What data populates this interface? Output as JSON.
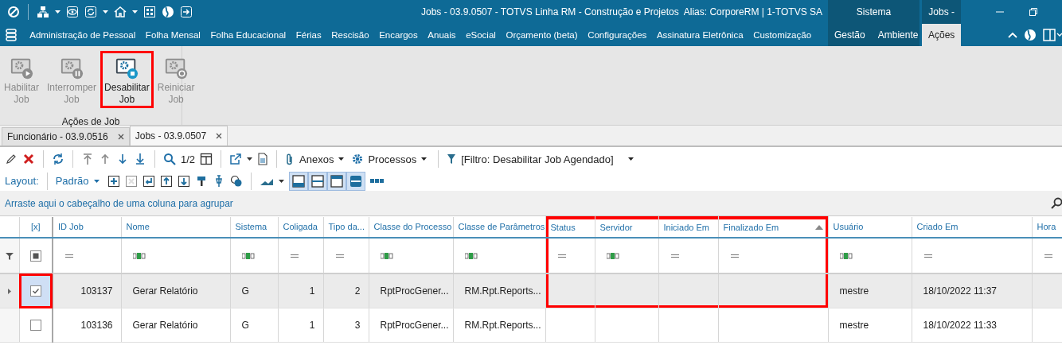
{
  "window": {
    "title": "Jobs - 03.9.0507 - TOTVS Linha RM - Construção e Projetos",
    "alias": "Alias: CorporeRM | 1-TOTVS SA"
  },
  "menu": {
    "items": [
      {
        "label": "Administração de Pessoal",
        "selected": false
      },
      {
        "label": "Folha Mensal",
        "selected": false
      },
      {
        "label": "Folha Educacional",
        "selected": false
      },
      {
        "label": "Férias",
        "selected": false
      },
      {
        "label": "Rescisão",
        "selected": false
      },
      {
        "label": "Encargos",
        "selected": false
      },
      {
        "label": "Anuais",
        "selected": false
      },
      {
        "label": "eSocial",
        "selected": false
      },
      {
        "label": "Orçamento (beta)",
        "selected": false
      },
      {
        "label": "Configurações",
        "selected": false
      },
      {
        "label": "Assinatura Eletrônica",
        "selected": false
      },
      {
        "label": "Customização",
        "selected": false
      }
    ]
  },
  "context_groups": [
    {
      "title": "Sistema",
      "tabs": [
        {
          "label": "Gestão",
          "selected": false
        },
        {
          "label": "Ambiente",
          "selected": false
        }
      ]
    },
    {
      "title": "Jobs -",
      "tabs": [
        {
          "label": "Ações",
          "selected": true
        }
      ]
    }
  ],
  "ribbon": {
    "groups": [
      {
        "label": "Ações de Job",
        "buttons": [
          {
            "label": "Habilitar Job",
            "disabled": true,
            "highlighted": false
          },
          {
            "label": "Interromper Job",
            "disabled": true,
            "highlighted": false
          },
          {
            "label": "Desabilitar Job",
            "disabled": false,
            "highlighted": true
          },
          {
            "label": "Reiniciar Job",
            "disabled": true,
            "highlighted": false
          }
        ]
      }
    ]
  },
  "document_tabs": [
    {
      "label": "Funcionário - 03.9.0516",
      "selected": false
    },
    {
      "label": "Jobs - 03.9.0507",
      "selected": true
    }
  ],
  "toolbar": {
    "page": "1/2",
    "attachments": "Anexos",
    "processes": "Processos",
    "filter": "[Filtro: Desabilitar Job Agendado]"
  },
  "layout_bar": {
    "label": "Layout:",
    "layout": "Padrão",
    "tools": [
      {
        "disabled": false
      },
      {
        "disabled": true
      },
      {
        "disabled": false
      },
      {
        "disabled": false
      },
      {
        "disabled": false
      },
      {
        "disabled": false
      },
      {
        "disabled": false
      },
      {
        "disabled": false
      }
    ],
    "view_toggles": [
      {
        "pressed": true
      },
      {
        "pressed": true
      },
      {
        "pressed": true
      },
      {
        "pressed": true
      }
    ]
  },
  "group_panel": {
    "hint": "Arraste aqui o cabeçalho de uma coluna para agrupar"
  },
  "grid": {
    "select_all_partial": true,
    "columns": [
      {
        "title": "[x]",
        "kind": "check",
        "highlighted": false
      },
      {
        "title": "ID Job",
        "kind": "data",
        "text_filter": false,
        "numeric": true,
        "highlighted": false
      },
      {
        "title": "Nome",
        "kind": "data",
        "text_filter": true,
        "numeric": false,
        "highlighted": false
      },
      {
        "title": "Sistema",
        "kind": "data",
        "text_filter": true,
        "numeric": false,
        "highlighted": false
      },
      {
        "title": "Coligada",
        "kind": "data",
        "text_filter": false,
        "numeric": true,
        "highlighted": false
      },
      {
        "title": "Tipo da...",
        "kind": "data",
        "text_filter": false,
        "numeric": true,
        "highlighted": false
      },
      {
        "title": "Classe do Processo",
        "kind": "data",
        "text_filter": true,
        "numeric": false,
        "highlighted": false
      },
      {
        "title": "Classe de Parâmetros",
        "kind": "data",
        "text_filter": true,
        "numeric": false,
        "highlighted": false
      },
      {
        "title": "Status",
        "kind": "data",
        "text_filter": false,
        "highlighted": true
      },
      {
        "title": "Servidor",
        "kind": "data",
        "text_filter": true,
        "highlighted": true
      },
      {
        "title": "Iniciado Em",
        "kind": "data",
        "text_filter": false,
        "highlighted": true
      },
      {
        "title": "Finalizado Em",
        "kind": "data",
        "text_filter": false,
        "highlighted": true,
        "sorted_ascending": true
      },
      {
        "title": "Usuário",
        "kind": "data",
        "text_filter": true,
        "numeric": false,
        "highlighted": false
      },
      {
        "title": "Criado Em",
        "kind": "data",
        "text_filter": false,
        "numeric": false,
        "highlighted": false
      },
      {
        "title": "Hora",
        "kind": "data",
        "text_filter": false,
        "highlighted": false
      }
    ],
    "rows": [
      {
        "selected": true,
        "checked": true,
        "check_highlighted": true,
        "cells": [
          null,
          "103137",
          "Gerar Relatório",
          "G",
          "1",
          "2",
          "RptProcGener...",
          "RM.Rpt.Reports...",
          null,
          null,
          null,
          null,
          "mestre",
          "18/10/2022 11:37",
          null
        ]
      },
      {
        "selected": false,
        "checked": false,
        "check_highlighted": false,
        "cells": [
          null,
          "103136",
          "Gerar Relatório",
          "G",
          "1",
          "3",
          "RptProcGener...",
          "RM.Rpt.Reports...",
          null,
          null,
          null,
          null,
          "mestre",
          "18/10/2022 11:33",
          null
        ]
      }
    ]
  }
}
